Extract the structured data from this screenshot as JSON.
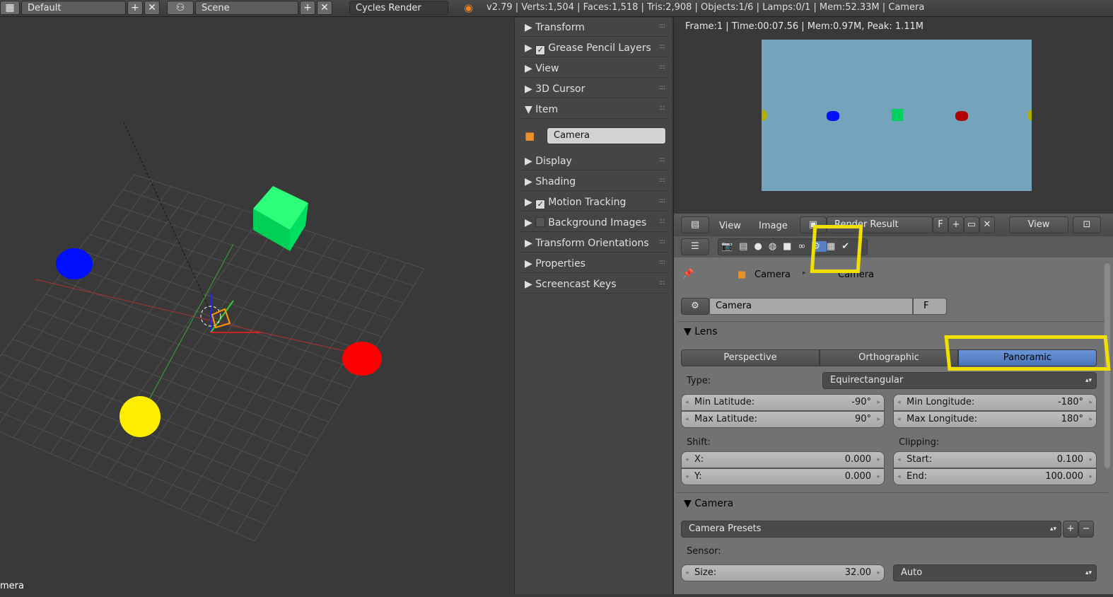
{
  "topbar": {
    "layout": "Default",
    "scene": "Scene",
    "engine": "Cycles Render",
    "stats": "v2.79 | Verts:1,504 | Faces:1,518 | Tris:2,908 | Objects:1/6 | Lamps:0/1 | Mem:52.33M | Camera"
  },
  "viewport": {
    "object_label": "mera"
  },
  "npanel": {
    "panels": [
      "Transform",
      "Grease Pencil Layers",
      "View",
      "3D Cursor",
      "Item",
      "Display",
      "Shading",
      "Motion Tracking",
      "Background Images",
      "Transform Orientations",
      "Properties",
      "Screencast Keys"
    ],
    "item_name": "Camera"
  },
  "image_editor": {
    "info": "Frame:1 | Time:00:07.56 | Mem:0.97M, Peak: 1.11M",
    "render_bg": "#74a4bb"
  },
  "image_header": {
    "view": "View",
    "image": "Image",
    "image_name": "Render Result",
    "fake_user": "F",
    "view_menu": "View"
  },
  "properties": {
    "breadcrumb": [
      "Camera",
      "Camera"
    ],
    "datablock": "Camera",
    "datablock_f": "F",
    "lens": {
      "title": "Lens",
      "tabs": [
        "Perspective",
        "Orthographic",
        "Panoramic"
      ],
      "active_tab": "Panoramic",
      "type_label": "Type:",
      "type_value": "Equirectangular",
      "min_lat_label": "Min Latitude:",
      "min_lat": "-90°",
      "max_lat_label": "Max Latitude:",
      "max_lat": "90°",
      "min_lon_label": "Min Longitude:",
      "min_lon": "-180°",
      "max_lon_label": "Max Longitude:",
      "max_lon": "180°",
      "shift_label": "Shift:",
      "shift_x_label": "X:",
      "shift_x": "0.000",
      "shift_y_label": "Y:",
      "shift_y": "0.000",
      "clip_label": "Clipping:",
      "clip_start_label": "Start:",
      "clip_start": "0.100",
      "clip_end_label": "End:",
      "clip_end": "100.000"
    },
    "camera": {
      "title": "Camera",
      "presets": "Camera Presets",
      "sensor_label": "Sensor:",
      "size_label": "Size:",
      "size": "32.00",
      "fit": "Auto"
    }
  },
  "colors": {
    "accent": "#5680c2",
    "highlight": "#f0e000"
  }
}
